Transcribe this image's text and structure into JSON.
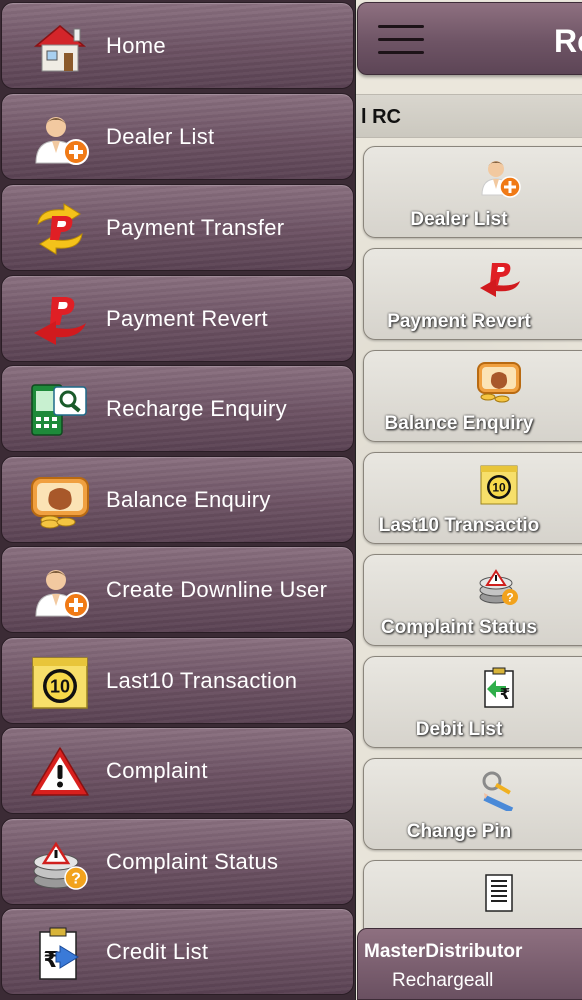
{
  "drawer": {
    "items": [
      {
        "label": "Home",
        "icon": "house-icon"
      },
      {
        "label": "Dealer List",
        "icon": "add-user-icon"
      },
      {
        "label": "Payment Transfer",
        "icon": "payment-transfer-icon"
      },
      {
        "label": "Payment Revert",
        "icon": "payment-revert-icon"
      },
      {
        "label": "Recharge Enquiry",
        "icon": "recharge-enquiry-icon"
      },
      {
        "label": "Balance Enquiry",
        "icon": "money-bag-icon"
      },
      {
        "label": "Create Downline User",
        "icon": "add-user-icon"
      },
      {
        "label": "Last10 Transaction",
        "icon": "last10-icon"
      },
      {
        "label": "Complaint",
        "icon": "warning-icon"
      },
      {
        "label": "Complaint Status",
        "icon": "complaint-status-icon"
      },
      {
        "label": "Credit List",
        "icon": "credit-list-icon"
      }
    ]
  },
  "app": {
    "title": "Re",
    "subheader": "l RC",
    "tiles": [
      {
        "label": "Dealer List",
        "icon": "add-user-icon"
      },
      {
        "label": "Payment Revert",
        "icon": "payment-revert-icon"
      },
      {
        "label": "Balance Enquiry",
        "icon": "money-bag-icon"
      },
      {
        "label": "Last10 Transactio",
        "icon": "last10-icon"
      },
      {
        "label": "Complaint Status",
        "icon": "complaint-status-icon"
      },
      {
        "label": "Debit List",
        "icon": "debit-list-icon"
      },
      {
        "label": "Change Pin",
        "icon": "change-pin-icon"
      },
      {
        "label": "",
        "icon": "report-icon"
      }
    ],
    "footer": {
      "role": "MasterDistributor",
      "username": "Rechargeall"
    }
  },
  "colors": {
    "drawer_item": "#6c5263",
    "drawer_bg": "#3b2b35",
    "tile_bg": "#e0ddd6",
    "accent_orange": "#f08a1c",
    "accent_red": "#d8201e"
  }
}
